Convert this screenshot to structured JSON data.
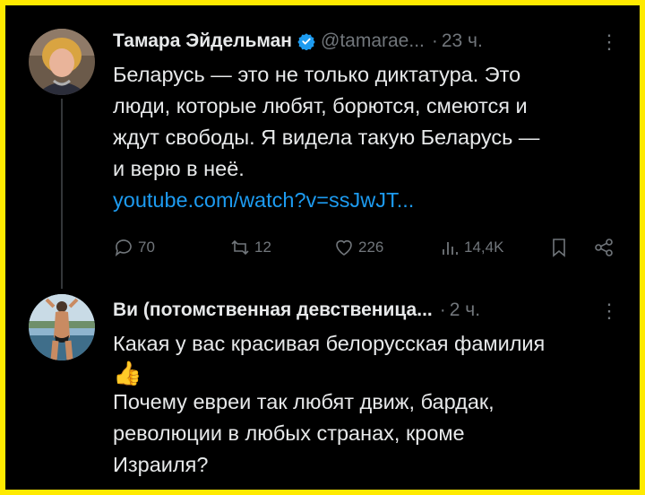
{
  "tweets": [
    {
      "author": "Тамара Эйдельман",
      "handle": "@tamarae...",
      "separator": "·",
      "time": "23 ч.",
      "more": "⋮",
      "lines": [
        "Беларусь — это не только диктатура. Это",
        "люди, которые любят, борются, смеются и",
        "ждут свободы. Я видела такую Беларусь —",
        "и верю в неё."
      ],
      "link": "youtube.com/watch?v=ssJwJT...",
      "actions": {
        "replies": "70",
        "reposts": "12",
        "likes": "226",
        "views": "14,4K"
      }
    },
    {
      "author": "Ви (потомственная девственица...",
      "separator": "·",
      "time": "2 ч.",
      "more": "⋮",
      "line1": "Какая у вас красивая белорусская фамилия",
      "emoji": "👍",
      "lines2": [
        "Почему евреи так любят движ, бардак,",
        "революции в любых странах, кроме",
        "Израиля?"
      ]
    }
  ],
  "colors": {
    "border": "#ffea00",
    "background": "#000000",
    "text": "#e7e9ea",
    "muted": "#71767b",
    "link": "#1d9bf0"
  },
  "icons": [
    "verified-badge-icon",
    "reply-icon",
    "repost-icon",
    "like-icon",
    "views-icon",
    "bookmark-icon",
    "share-icon",
    "more-icon"
  ]
}
